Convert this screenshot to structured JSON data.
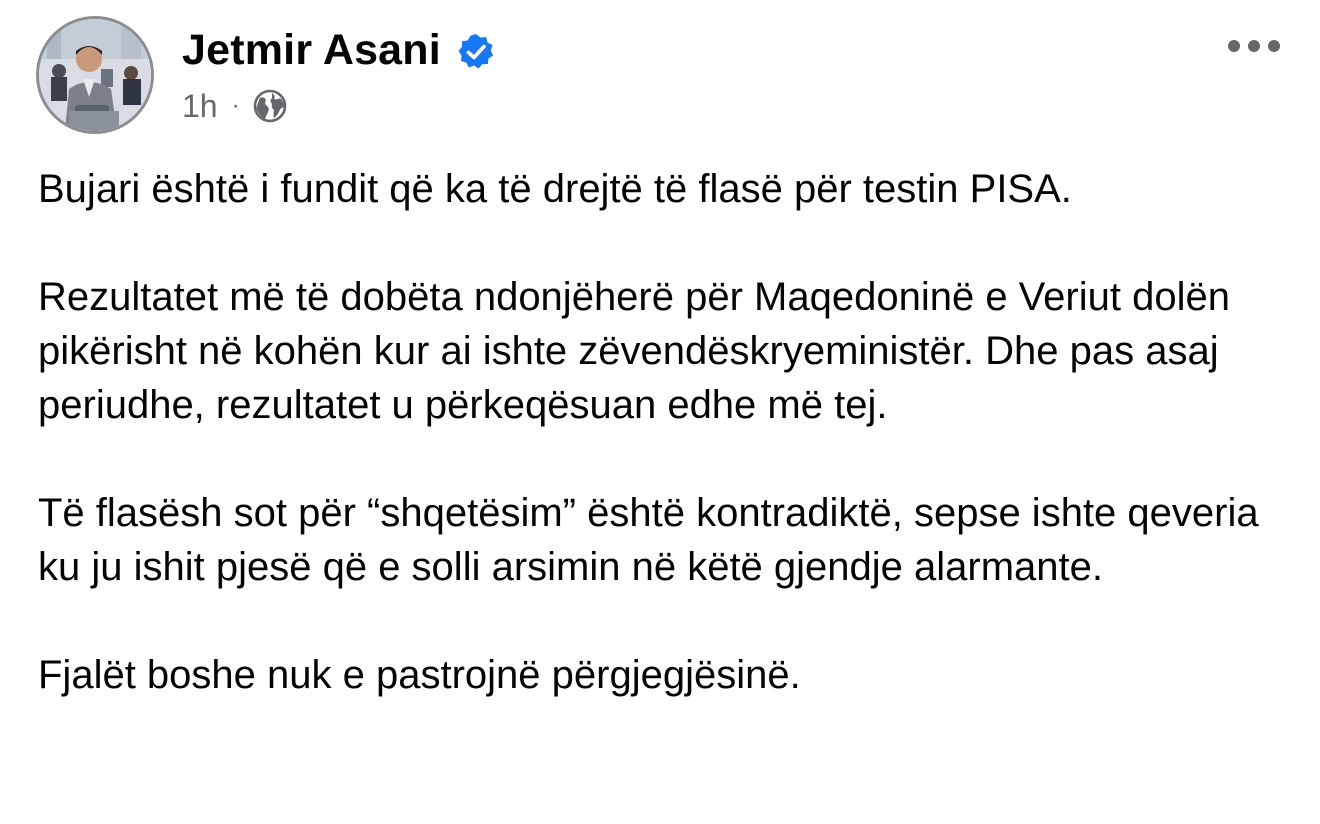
{
  "post": {
    "author": {
      "name": "Jetmir Asani",
      "verified": true,
      "avatar_icon": "profile-photo"
    },
    "meta": {
      "time": "1h",
      "separator": "·",
      "audience_icon": "globe-icon"
    },
    "more_icon": "more-options-icon",
    "paragraphs": [
      "Bujari është i fundit që ka të drejtë të flasë për testin PISA.",
      "Rezultatet më të dobëta ndonjëherë për Maqedoninë e Veriut dolën pikërisht në kohën kur ai ishte zëvendëskryeministër. Dhe pas asaj periudhe, rezultatet u përkeqësuan edhe më tej.",
      "Të flasësh sot për “shqetësim” është kontradiktë, sepse ishte qeveria ku ju ishit pjesë që e solli arsimin në këtë gjendje alarmante.",
      "Fjalët boshe nuk e pastrojnë përgjegjësinë."
    ]
  },
  "colors": {
    "text": "#050505",
    "secondary": "#65676b",
    "verified_badge": "#1877f2",
    "avatar_ring": "#8a8d91"
  }
}
